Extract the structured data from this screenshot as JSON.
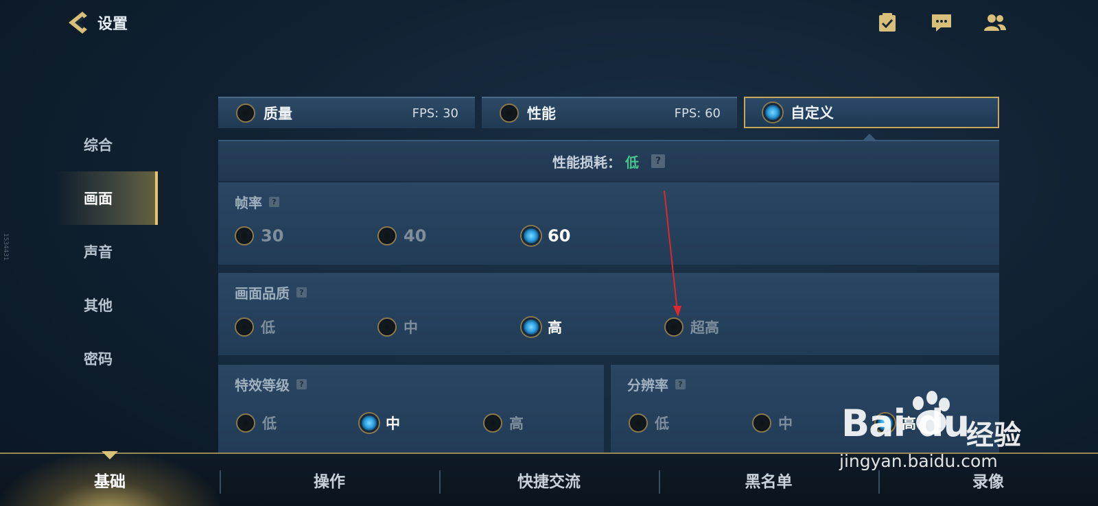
{
  "header": {
    "back_label": "设置",
    "icons": [
      "checklist-icon",
      "chat-icon",
      "friends-icon"
    ]
  },
  "side_id": "1534431",
  "sidebar": {
    "items": [
      {
        "label": "综合",
        "active": false
      },
      {
        "label": "画面",
        "active": true
      },
      {
        "label": "声音",
        "active": false
      },
      {
        "label": "其他",
        "active": false
      },
      {
        "label": "密码",
        "active": false
      }
    ]
  },
  "presets": [
    {
      "name": "质量",
      "fps": "FPS: 30",
      "selected": false
    },
    {
      "name": "性能",
      "fps": "FPS: 60",
      "selected": false
    },
    {
      "name": "自定义",
      "fps": "",
      "selected": true
    }
  ],
  "performance": {
    "label": "性能损耗：",
    "value": "低",
    "value_color": "#49c48a"
  },
  "sections": {
    "frame_rate": {
      "title": "帧率",
      "options": [
        "30",
        "40",
        "60"
      ],
      "selected": "60"
    },
    "quality": {
      "title": "画面品质",
      "options": [
        "低",
        "中",
        "高",
        "超高"
      ],
      "selected": "高"
    },
    "effects": {
      "title": "特效等级",
      "options": [
        "低",
        "中",
        "高"
      ],
      "selected": "中"
    },
    "resolution": {
      "title": "分辨率",
      "options": [
        "低",
        "中",
        "高"
      ],
      "selected": "高"
    }
  },
  "bottom_tabs": [
    {
      "label": "基础",
      "active": true
    },
    {
      "label": "操作",
      "active": false
    },
    {
      "label": "快捷交流",
      "active": false
    },
    {
      "label": "黑名单",
      "active": false
    },
    {
      "label": "录像",
      "active": false
    }
  ],
  "watermark": {
    "logo": "Bai du",
    "brand": "经验",
    "url": "jingyan.baidu.com"
  },
  "help_glyph": "?",
  "colors": {
    "accent_gold": "#c9a85a",
    "selected_radio": "#2a9fe0",
    "annotation_arrow": "#e0282b"
  }
}
